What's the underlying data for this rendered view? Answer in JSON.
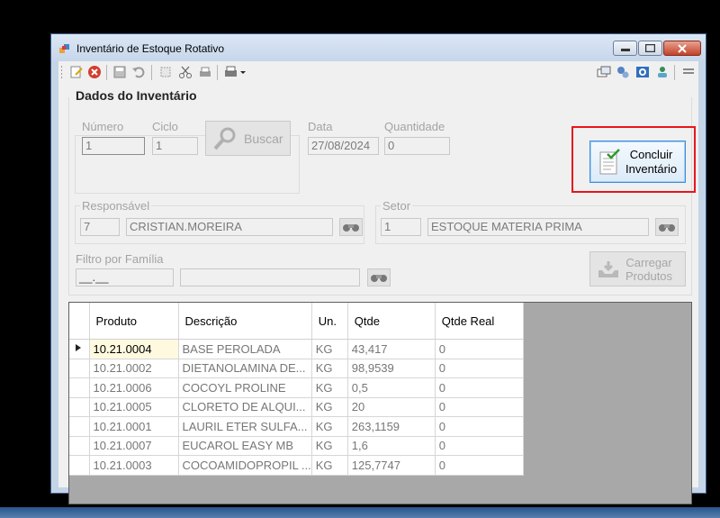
{
  "window": {
    "title": "Inventário de Estoque Rotativo"
  },
  "group": {
    "title": "Dados do Inventário"
  },
  "numero": {
    "label": "Número",
    "value": "1"
  },
  "ciclo": {
    "label": "Ciclo",
    "value": "1"
  },
  "buscar": {
    "label": "Buscar"
  },
  "data": {
    "label": "Data",
    "value": "27/08/2024"
  },
  "quantidade": {
    "label": "Quantidade",
    "value": "0"
  },
  "concluir": {
    "line1": "Concluir",
    "line2": "Inventário"
  },
  "responsavel": {
    "label": "Responsável",
    "code": "7",
    "name": "CRISTIAN.MOREIRA"
  },
  "setor": {
    "label": "Setor",
    "code": "1",
    "name": "ESTOQUE MATERIA PRIMA"
  },
  "filtro": {
    "label": "Filtro por Família",
    "mask": "__.__",
    "desc": ""
  },
  "carregar": {
    "line1": "Carregar",
    "line2": "Produtos"
  },
  "table": {
    "columns": [
      "Produto",
      "Descrição",
      "Un.",
      "Qtde",
      "Qtde Real"
    ],
    "rows": [
      [
        "10.21.0004",
        "BASE PEROLADA",
        "KG",
        "43,417",
        "0"
      ],
      [
        "10.21.0002",
        "DIETANOLAMINA DE...",
        "KG",
        "98,9539",
        "0"
      ],
      [
        "10.21.0006",
        "COCOYL PROLINE",
        "KG",
        "0,5",
        "0"
      ],
      [
        "10.21.0005",
        "CLORETO DE ALQUI...",
        "KG",
        "20",
        "0"
      ],
      [
        "10.21.0001",
        "LAURIL ETER SULFA...",
        "KG",
        "263,1159",
        "0"
      ],
      [
        "10.21.0007",
        "EUCAROL EASY MB",
        "KG",
        "1,6",
        "0"
      ],
      [
        "10.21.0003",
        "COCOAMIDOPROPIL ...",
        "KG",
        "125,7747",
        "0"
      ]
    ]
  }
}
